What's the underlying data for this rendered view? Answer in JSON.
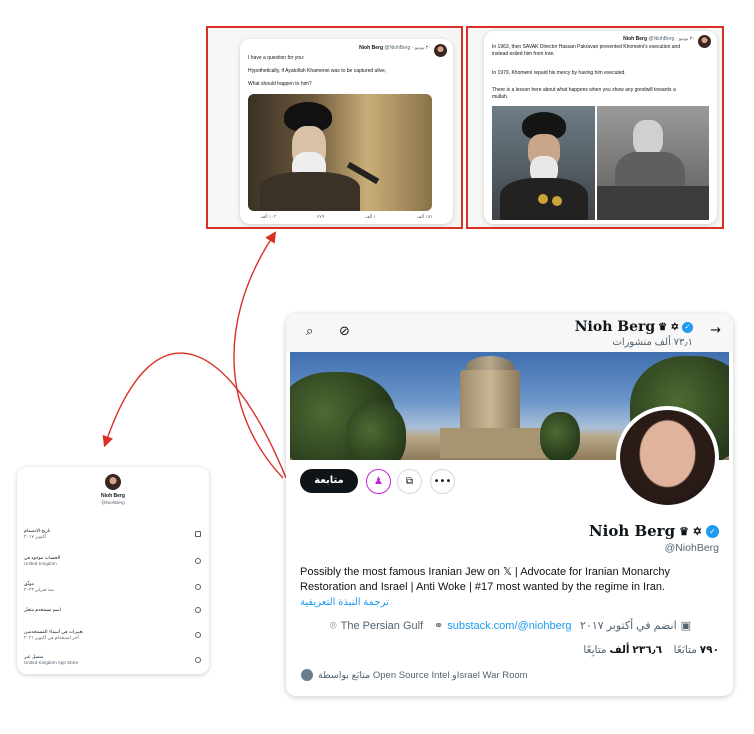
{
  "tweet_left": {
    "author": "Nioh Berg",
    "meta": "@NiohBerg · ٣٠ يونيو",
    "lines": [
      "I have a question for you:",
      "Hypothetically, if Ayatollah Khamenei was to be captured alive,",
      "What should happen to him?"
    ],
    "actions": [
      "١٠٣ ألف",
      "٢٧٩",
      "١ ألف",
      "١٥١ ألف"
    ]
  },
  "tweet_right": {
    "author": "Nioh Berg",
    "meta": "@NiohBerg · ٣٠ يونيو",
    "lines": [
      "In 1963, then SAVAK Director Hassan Pakravan prevented Khomeini's execution and instead exiled him from Iran.",
      "In 1979, Khomeini repaid his mercy by having him executed.",
      "There is a lesson here about what happens when you show any goodwill towards a mullah."
    ]
  },
  "sidecard": {
    "name": "Nioh Berg",
    "handle": "@NiohBerg",
    "rows": [
      {
        "title": "تاريخ الانضمام",
        "sub": "أكتوبر ٢٠١٧"
      },
      {
        "title": "الحساب موجود في",
        "sub": "United Kingdom"
      },
      {
        "title": "موثّق",
        "sub": "منذ فبراير ٢٠٢٣"
      },
      {
        "title": "اسم مستخدم متغيّر",
        "sub": ""
      },
      {
        "title": "تغييرات في أسماء المستخدمين",
        "sub": "آخر استخدام في أكتوبر ٢٠٢١"
      },
      {
        "title": "متصل عبر",
        "sub": "United Kingdom App Store"
      }
    ]
  },
  "profile": {
    "top_name": "Nioh Berg",
    "name_emojis": "♛ ✡",
    "posts_count": "٧٣٫١ ألف منشورات",
    "follow_label": "متابعة",
    "display_name": "Nioh Berg",
    "handle": "@NiohBerg",
    "bio": "Possibly the most famous Iranian Jew on 𝕏 | Advocate for Iranian Monarchy Restoration and Israel | Anti Woke | #17 most wanted by the regime in Iran.",
    "translate_label": "ترجمة النبذة التعريفية",
    "location": "The Persian Gulf",
    "website": "substack.com/@niohberg",
    "joined": "انضم في أكتوبر ٢٠١٧",
    "following_count": "٧٩٠",
    "following_label": "متابَعًا",
    "followers_count": "٢٣٦٫٦ ألف",
    "followers_label": "متابِعًا",
    "followed_by": "متابَع بواسطة Open Source Intel وIsrael War Room"
  },
  "colors": {
    "accent": "#1d9bf0",
    "annotation": "#d93025",
    "follow_button": "#0f1419"
  },
  "icons": [
    "search-icon",
    "mute-icon",
    "back-arrow-icon",
    "more-icon",
    "notification-icon",
    "subscribe-icon",
    "location-icon",
    "link-icon",
    "calendar-icon",
    "verified-badge-icon"
  ]
}
